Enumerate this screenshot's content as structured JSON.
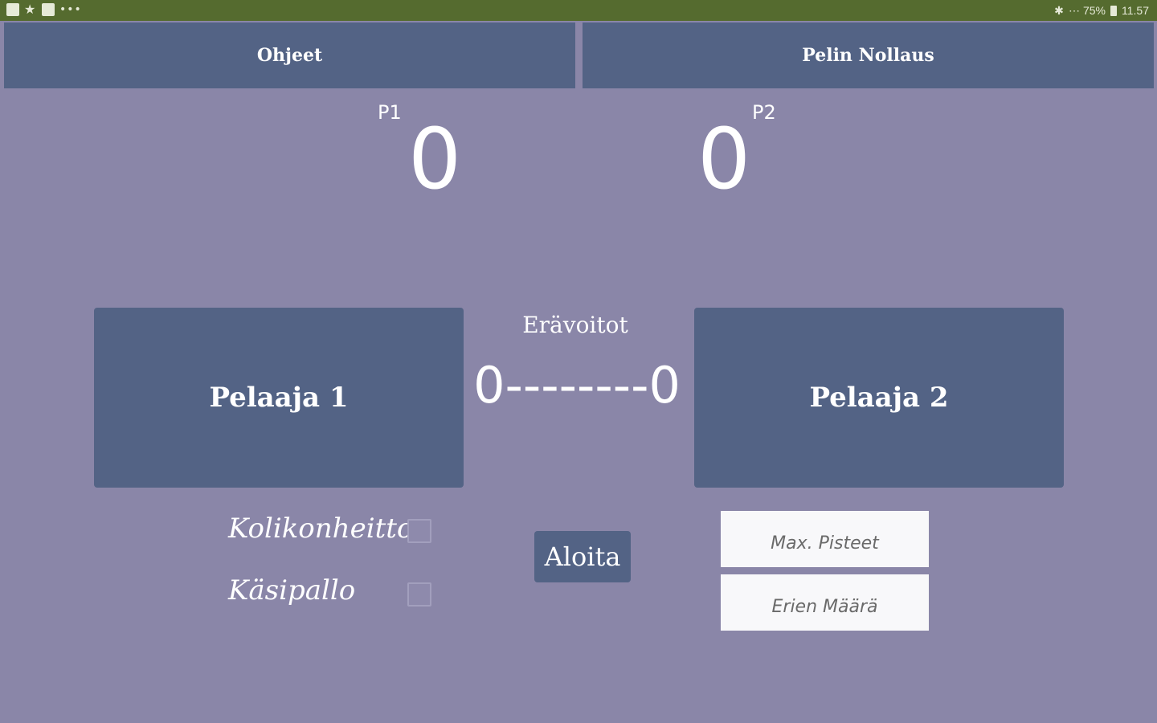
{
  "status_bar": {
    "left_icons": [
      "gallery-icon",
      "star-icon",
      "image-icon",
      "more-dots-icon"
    ],
    "bluetooth": "✱",
    "wifi_signal": "⋯",
    "battery": "75%",
    "time": "11.57"
  },
  "top_buttons": {
    "instructions": "Ohjeet",
    "reset": "Pelin Nollaus"
  },
  "scores": {
    "p1_label": "P1",
    "p1_value": "0",
    "p2_label": "P2",
    "p2_value": "0"
  },
  "players": {
    "player1": "Pelaaja 1",
    "player2": "Pelaaja 2"
  },
  "sets": {
    "title": "Erävoitot",
    "score": "0--------0"
  },
  "options": {
    "coin_toss": "Kolikonheitto",
    "handball": "Käsipallo"
  },
  "start_button": "Aloita",
  "fields": {
    "max_points_placeholder": "Max. Pisteet",
    "sets_placeholder": "Erien Määrä"
  },
  "colors": {
    "background": "#8a86a8",
    "button": "#536385",
    "status_bar": "#556b2f"
  }
}
